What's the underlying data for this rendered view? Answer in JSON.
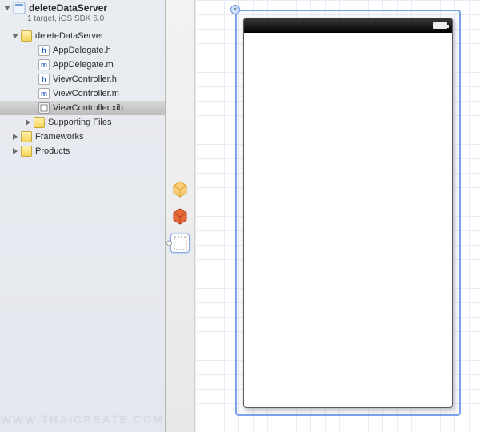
{
  "project": {
    "name": "deleteDataServer",
    "subtitle": "1 target, iOS SDK 6.0"
  },
  "tree": {
    "root_folder": "deleteDataServer",
    "files": {
      "app_delegate_h": "AppDelegate.h",
      "app_delegate_m": "AppDelegate.m",
      "view_controller_h": "ViewController.h",
      "view_controller_m": "ViewController.m",
      "view_controller_xib": "ViewController.xib",
      "supporting": "Supporting Files"
    },
    "frameworks": "Frameworks",
    "products": "Products"
  },
  "outline": {
    "files_owner": "File's Owner",
    "first_responder": "First Responder",
    "view": "View"
  },
  "watermark": "WWW.THAICREATE.COM"
}
